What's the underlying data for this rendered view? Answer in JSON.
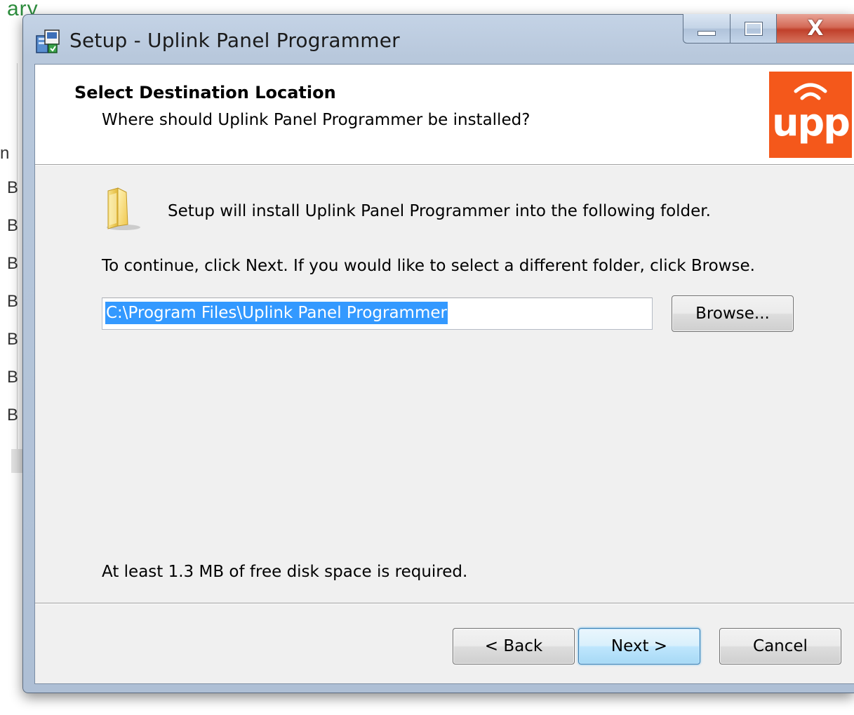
{
  "background": {
    "fragment_top": "ary",
    "fragment_h": "n",
    "rows": [
      "B",
      "B",
      "B",
      "B",
      "B",
      "B",
      "B"
    ]
  },
  "window": {
    "title": "Setup - Uplink Panel Programmer",
    "close_glyph": "X"
  },
  "header": {
    "title": "Select Destination Location",
    "subtitle": "Where should Uplink Panel Programmer be installed?",
    "logo_text": "upp",
    "logo_color": "#f4581b"
  },
  "body": {
    "info": "Setup will install Uplink Panel Programmer into the following folder.",
    "instruction": "To continue, click Next. If you would like to select a different folder, click Browse.",
    "path_value": "C:\\Program Files\\Uplink Panel Programmer",
    "browse_label": "Browse...",
    "space_required": "At least 1.3 MB of free disk space is required."
  },
  "footer": {
    "back_label": "< Back",
    "next_label": "Next >",
    "cancel_label": "Cancel"
  },
  "icons": {
    "title": "setup-installer-icon",
    "folder": "folder-icon",
    "logo": "wifi-signal-icon"
  },
  "colors": {
    "selection": "#3399ff",
    "focus_button": "#3c7fb1"
  }
}
